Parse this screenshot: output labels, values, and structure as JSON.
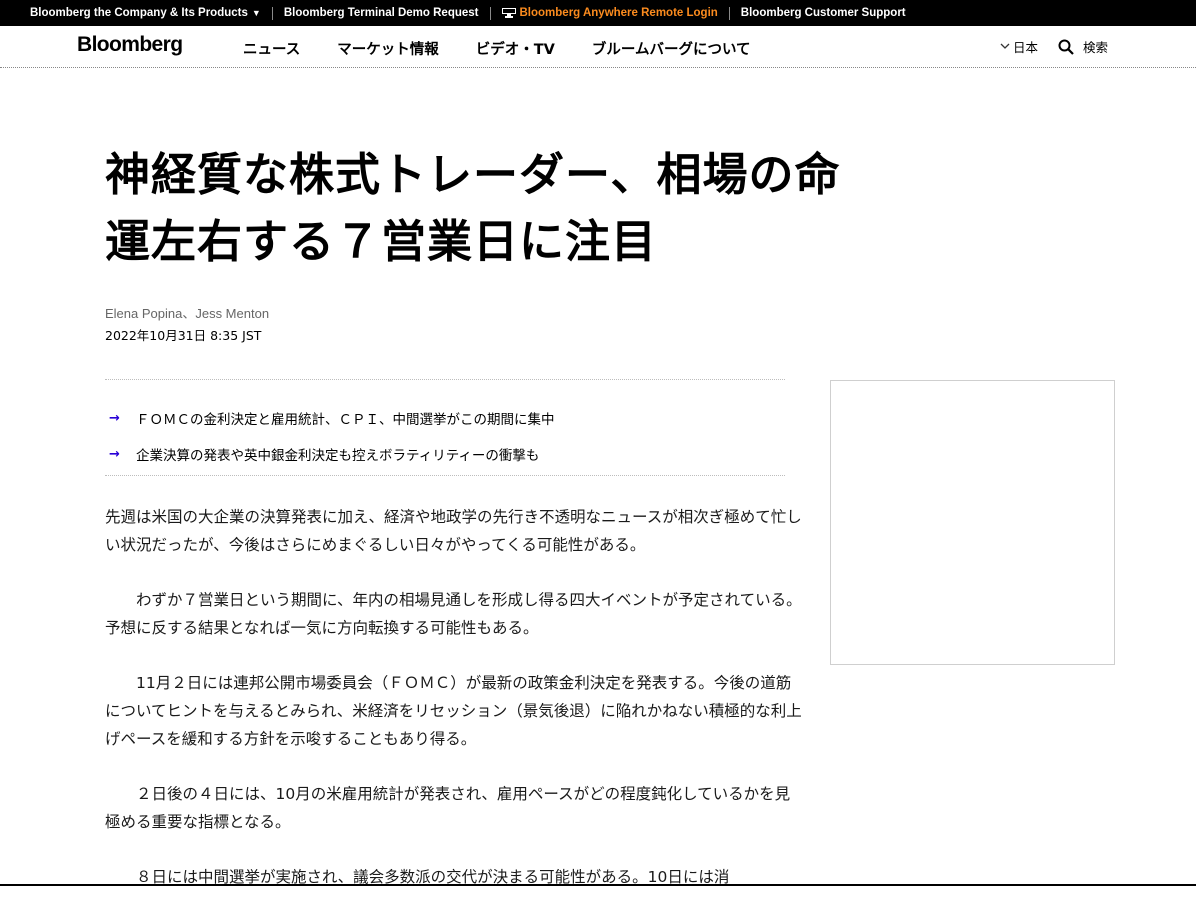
{
  "utility_bar": {
    "items": [
      {
        "label": "Bloomberg the Company & Its Products",
        "caret": "▼"
      },
      {
        "label": "Bloomberg Terminal Demo Request"
      },
      {
        "label": "Bloomberg Anywhere Remote Login"
      },
      {
        "label": "Bloomberg Customer Support"
      }
    ],
    "accent_color": "#fb8b1e"
  },
  "nav": {
    "logo": "Bloomberg",
    "links": [
      "ニュース",
      "マーケット情報",
      "ビデオ・TV",
      "ブルームバーグについて"
    ],
    "edition_label": "日本",
    "search_label": "検索"
  },
  "article": {
    "headline_line1": "神経質な株式トレーダー、相場の命",
    "headline_line2": "運左右する７営業日に注目",
    "authors": "Elena Popina、Jess Menton",
    "date": "2022年10月31日 8:35 JST",
    "summary": [
      "ＦＯＭＣの金利決定と雇用統計、ＣＰＩ、中間選挙がこの期間に集中",
      "企業決算の発表や英中銀金利決定も控えボラティリティーの衝撃も"
    ],
    "paragraphs": [
      "先週は米国の大企業の決算発表に加え、経済や地政学の先行き不透明なニュースが相次ぎ極めて忙しい状況だったが、今後はさらにめまぐるしい日々がやってくる可能性がある。",
      "　　わずか７営業日という期間に、年内の相場見通しを形成し得る四大イベントが予定されている。予想に反する結果となれば一気に方向転換する可能性もある。",
      "　　11月２日には連邦公開市場委員会（ＦＯＭＣ）が最新の政策金利決定を発表する。今後の道筋についてヒントを与えるとみられ、米経済をリセッション（景気後退）に陥れかねない積極的な利上げペースを緩和する方針を示唆することもあり得る。",
      "　　２日後の４日には、10月の米雇用統計が発表され、雇用ペースがどの程度鈍化しているかを見極める重要な指標となる。",
      "　　８日には中間選挙が実施され、議会多数派の交代が決まる可能性がある。10日には消"
    ]
  }
}
